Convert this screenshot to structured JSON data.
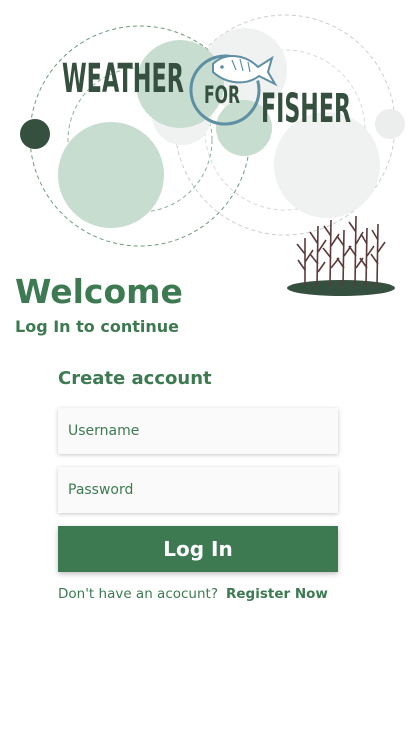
{
  "logo": {
    "word_1": "WEATHER",
    "word_2": "FOR",
    "word_3": "FISHER"
  },
  "colors": {
    "primary": "#3d7a52",
    "dark": "#35503f",
    "light_green": "#c6ddd0",
    "pale_gray": "#f0f1f1"
  },
  "welcome": {
    "title": "Welcome",
    "subtitle": "Log In to continue"
  },
  "form": {
    "title": "Create account",
    "username_placeholder": "Username",
    "password_placeholder": "Password",
    "login_label": "Log In",
    "no_account_text": "Don't have an acocunt?",
    "register_label": "Register Now"
  },
  "icons": [
    "fish-icon",
    "reeds-illustration"
  ]
}
